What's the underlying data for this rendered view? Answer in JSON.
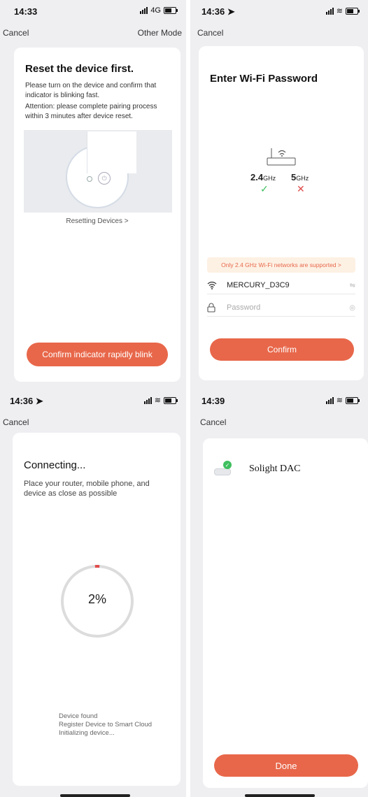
{
  "screen1": {
    "time": "14:33",
    "network": "4G",
    "cancel": "Cancel",
    "other_mode": "Other Mode",
    "title": "Reset the device first.",
    "description": "Please turn on the device and confirm that indicator is blinking fast.",
    "attention": "Attention: please complete pairing process within 3 minutes after device reset.",
    "resetting_link": "Resetting Devices >",
    "confirm_button": "Confirm indicator rapidly blink"
  },
  "screen2": {
    "time": "14:36 ➤",
    "cancel": "Cancel",
    "title": "Enter Wi-Fi Password",
    "band_24": "2.4",
    "band_5": "5",
    "unit": "GHz",
    "notice": "Only 2.4 GHz Wi-Fi networks are supported >",
    "ssid": "MERCURY_D3C9",
    "password_placeholder": "Password",
    "confirm_button": "Confirm"
  },
  "screen3": {
    "time": "14:36 ➤",
    "cancel": "Cancel",
    "title": "Connecting...",
    "description": "Place your router, mobile phone, and device as close as possible",
    "progress": "2%",
    "progress_fraction": 0.02,
    "steps": [
      "Device found",
      "Register Device to Smart Cloud",
      "Initializing device..."
    ]
  },
  "screen4": {
    "time": "14:39",
    "cancel": "Cancel",
    "device_name": "Solight DAC",
    "done_button": "Done"
  },
  "colors": {
    "accent": "#e8674a",
    "success": "#3fbf5f",
    "error": "#e04c4c"
  }
}
